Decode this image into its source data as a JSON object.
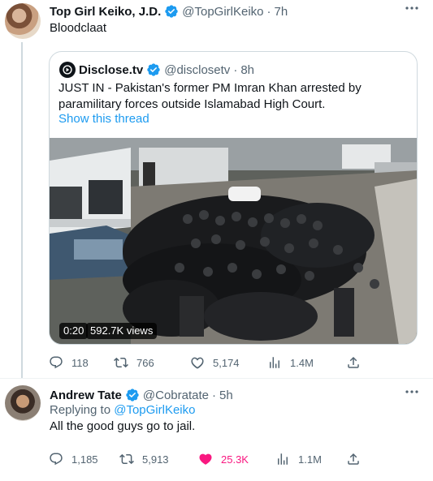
{
  "tweet1": {
    "name": "Top Girl Keiko, J.D.",
    "handle": "@TopGirlKeiko",
    "separator": "·",
    "time": "7h",
    "text": "Bloodclaat",
    "quote": {
      "name": "Disclose.tv",
      "handle": "@disclosetv",
      "separator": "·",
      "time": "8h",
      "text": "JUST IN - Pakistan's former PM Imran Khan arrested by paramilitary forces outside Islamabad High Court.",
      "link": "Show this thread",
      "video_time": "0:20",
      "video_views": "592.7K views"
    },
    "stats": {
      "replies": "118",
      "retweets": "766",
      "likes": "5,174",
      "views": "1.4M"
    }
  },
  "tweet2": {
    "name": "Andrew Tate",
    "handle": "@Cobratate",
    "separator": "·",
    "time": "5h",
    "replying_prefix": "Replying to ",
    "replying_to": "@TopGirlKeiko",
    "text": "All the good guys go to jail.",
    "stats": {
      "replies": "1,185",
      "retweets": "5,913",
      "likes": "25.3K",
      "views": "1.1M"
    }
  },
  "colors": {
    "accent": "#1d9bf0",
    "like": "#f91880",
    "muted": "#536471"
  }
}
